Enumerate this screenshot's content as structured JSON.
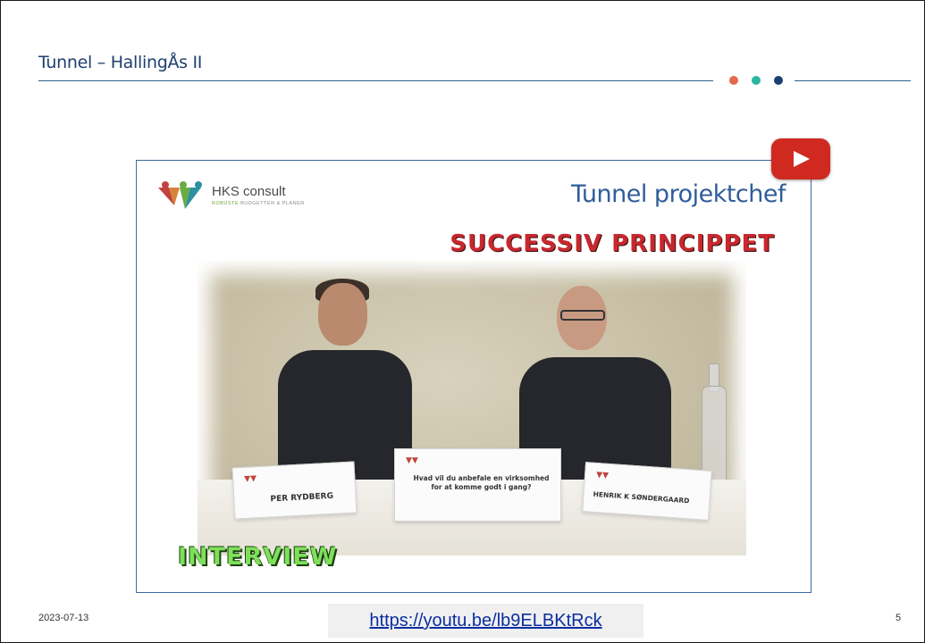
{
  "slide": {
    "title": "Tunnel – HallingÅs II",
    "dots": [
      {
        "icon": "dot-icon",
        "color": "#e36a4c"
      },
      {
        "icon": "dot-icon",
        "color": "#2bb6a0"
      },
      {
        "icon": "dot-icon",
        "color": "#1c3f73"
      }
    ]
  },
  "video": {
    "play_button_icon": "youtube-play-icon",
    "logo": {
      "name": "HKS consult",
      "tagline_a": "ROBUSTE",
      "tagline_b": "BUDGETTER & PLANER"
    },
    "heading_main": "Tunnel projektchef",
    "heading_sub": "SUCCESSIV PRINCIPPET",
    "overlay_label": "INTERVIEW",
    "name_cards": [
      {
        "text": "PER RYDBERG"
      },
      {
        "text": "Hvad vil du anbefale en virksomhed for at komme godt i gang?"
      },
      {
        "text": "HENRIK K SØNDERGAARD"
      }
    ]
  },
  "footer": {
    "date": "2023-07-13",
    "link": "https://youtu.be/lb9ELBKtRck",
    "page_number": "5"
  }
}
